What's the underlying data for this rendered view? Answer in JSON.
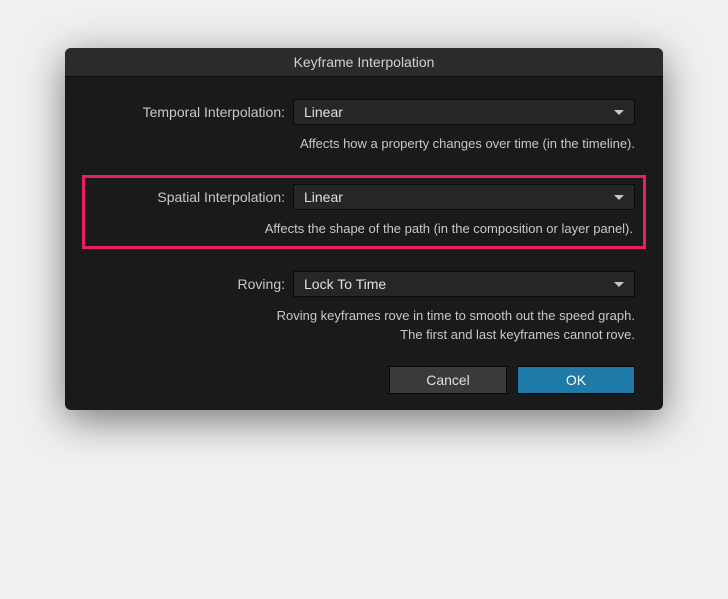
{
  "dialog": {
    "title": "Keyframe Interpolation"
  },
  "temporal": {
    "label": "Temporal Interpolation:",
    "value": "Linear",
    "description": "Affects how a property changes over time (in the timeline)."
  },
  "spatial": {
    "label": "Spatial Interpolation:",
    "value": "Linear",
    "description": "Affects the shape of the path (in the composition or layer panel)."
  },
  "roving": {
    "label": "Roving:",
    "value": "Lock To Time",
    "description": "Roving keyframes rove in time to smooth out the speed graph.\nThe first and last keyframes cannot rove."
  },
  "buttons": {
    "cancel": "Cancel",
    "ok": "OK"
  }
}
